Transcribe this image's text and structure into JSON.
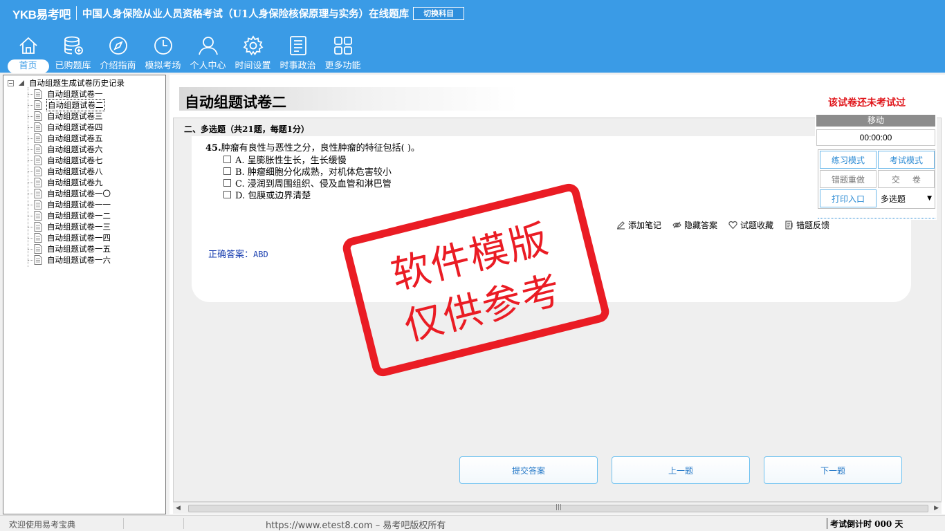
{
  "header": {
    "logo": "YKB易考吧",
    "title": "中国人身保险从业人员资格考试（U1人身保险核保原理与实务）在线题库",
    "switch_label": "切换科目",
    "nav": [
      {
        "label": "首页",
        "icon": "home-icon",
        "active": true
      },
      {
        "label": "已购题库",
        "icon": "database-icon"
      },
      {
        "label": "介绍指南",
        "icon": "compass-icon"
      },
      {
        "label": "模拟考场",
        "icon": "clock-icon"
      },
      {
        "label": "个人中心",
        "icon": "user-icon"
      },
      {
        "label": "时间设置",
        "icon": "gear-icon"
      },
      {
        "label": "时事政治",
        "icon": "news-icon"
      },
      {
        "label": "更多功能",
        "icon": "grid-icon"
      }
    ]
  },
  "sidebar": {
    "root": "自动组题生成试卷历史记录",
    "items": [
      "自动组题试卷一",
      "自动组题试卷二",
      "自动组题试卷三",
      "自动组题试卷四",
      "自动组题试卷五",
      "自动组题试卷六",
      "自动组题试卷七",
      "自动组题试卷八",
      "自动组题试卷九",
      "自动组题试卷一〇",
      "自动组题试卷一一",
      "自动组题试卷一二",
      "自动组题试卷一三",
      "自动组题试卷一四",
      "自动组题试卷一五",
      "自动组题试卷一六"
    ],
    "selected_index": 1
  },
  "main": {
    "paper_title": "自动组题试卷二",
    "status": "该试卷还未考试过",
    "section": "二、多选题（共21题，每题1分）",
    "question": {
      "number": "45.",
      "stem": "肿瘤有良性与恶性之分，良性肿瘤的特征包括( )。",
      "options": [
        "A. 呈膨胀性生长，生长缓慢",
        "B. 肿瘤细胞分化成熟，对机体危害较小",
        "C. 浸润到周围组织、侵及血管和淋巴管",
        "D. 包膜或边界清楚"
      ]
    },
    "actions": {
      "note": "添加笔记",
      "hide_answer": "隐藏答案",
      "favorite": "试题收藏",
      "feedback": "错题反馈"
    },
    "answer_label": "正确答案：",
    "answer_value": "ABD",
    "buttons": {
      "submit": "提交答案",
      "prev": "上一题",
      "next": "下一题"
    }
  },
  "tool": {
    "header": "移动",
    "timer": "00:00:00",
    "practice": "练习模式",
    "exam": "考试模式",
    "redo": "错题重做",
    "hand_in": "交卷",
    "print": "打印入口",
    "type_select": "多选题"
  },
  "stamp": {
    "line1": "软件模版",
    "line2": "仅供参考"
  },
  "statusbar": {
    "welcome": "欢迎使用易考宝典",
    "copyright": "https://www.etest8.com – 易考吧版权所有",
    "countdown": "考试倒计时 000 天"
  },
  "colors": {
    "header": "#3a9be6",
    "stamp": "#ea1c24",
    "status_red": "#e0151a",
    "link_blue": "#2a8ad4"
  }
}
